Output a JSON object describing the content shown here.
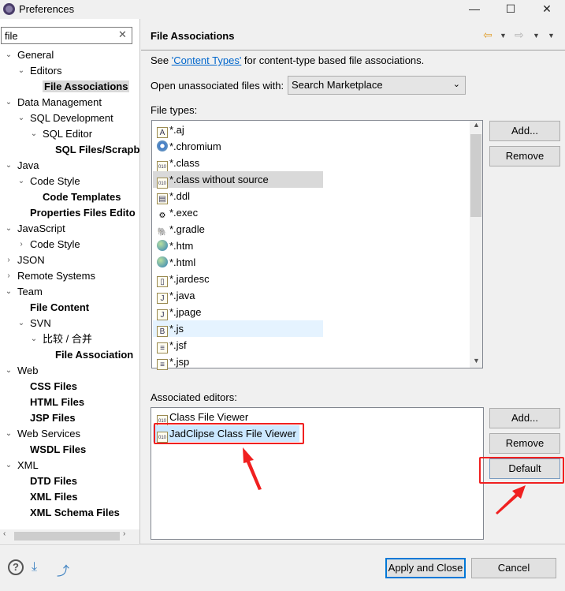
{
  "window": {
    "title": "Preferences",
    "icon": "eclipse-gear-icon",
    "minimize": "—",
    "maximize": "☐",
    "close": "✕"
  },
  "search": {
    "value": "file",
    "clear": "✕"
  },
  "tree": [
    {
      "label": "General",
      "level": 0,
      "state": "expanded"
    },
    {
      "label": "Editors",
      "level": 1,
      "state": "expanded"
    },
    {
      "label": "File Associations",
      "level": 2,
      "state": "leaf",
      "bold": true,
      "selected": true
    },
    {
      "label": "Data Management",
      "level": 0,
      "state": "expanded"
    },
    {
      "label": "SQL Development",
      "level": 1,
      "state": "expanded"
    },
    {
      "label": "SQL Editor",
      "level": 2,
      "state": "expanded"
    },
    {
      "label": "SQL Files/Scrapb",
      "level": 3,
      "state": "leaf",
      "bold": true
    },
    {
      "label": "Java",
      "level": 0,
      "state": "expanded"
    },
    {
      "label": "Code Style",
      "level": 1,
      "state": "expanded"
    },
    {
      "label": "Code Templates",
      "level": 2,
      "state": "leaf",
      "bold": true
    },
    {
      "label": "Properties Files Edito",
      "level": 1,
      "state": "leaf",
      "bold": true
    },
    {
      "label": "JavaScript",
      "level": 0,
      "state": "expanded"
    },
    {
      "label": "Code Style",
      "level": 1,
      "state": "collapsed"
    },
    {
      "label": "JSON",
      "level": 0,
      "state": "collapsed"
    },
    {
      "label": "Remote Systems",
      "level": 0,
      "state": "collapsed"
    },
    {
      "label": "Team",
      "level": 0,
      "state": "expanded"
    },
    {
      "label": "File Content",
      "level": 1,
      "state": "leaf",
      "bold": true
    },
    {
      "label": "SVN",
      "level": 1,
      "state": "expanded"
    },
    {
      "label": "比较 / 合并",
      "level": 2,
      "state": "expanded"
    },
    {
      "label": "File Association",
      "level": 3,
      "state": "leaf",
      "bold": true
    },
    {
      "label": "Web",
      "level": 0,
      "state": "expanded"
    },
    {
      "label": "CSS Files",
      "level": 1,
      "state": "leaf",
      "bold": true
    },
    {
      "label": "HTML Files",
      "level": 1,
      "state": "leaf",
      "bold": true
    },
    {
      "label": "JSP Files",
      "level": 1,
      "state": "leaf",
      "bold": true
    },
    {
      "label": "Web Services",
      "level": 0,
      "state": "expanded"
    },
    {
      "label": "WSDL Files",
      "level": 1,
      "state": "leaf",
      "bold": true
    },
    {
      "label": "XML",
      "level": 0,
      "state": "expanded"
    },
    {
      "label": "DTD Files",
      "level": 1,
      "state": "leaf",
      "bold": true
    },
    {
      "label": "XML Files",
      "level": 1,
      "state": "leaf",
      "bold": true
    },
    {
      "label": "XML Schema Files",
      "level": 1,
      "state": "leaf",
      "bold": true
    }
  ],
  "page": {
    "title": "File Associations",
    "see_prefix": "See ",
    "see_link": "'Content Types'",
    "see_suffix": " for content-type based file associations.",
    "open_label": "Open unassociated files with:",
    "open_value": "Search Marketplace",
    "file_types_label": "File types:",
    "file_types": [
      {
        "label": "*.aj",
        "icon": "aspectj-file-icon"
      },
      {
        "label": "*.chromium",
        "icon": "chromium-icon"
      },
      {
        "label": "*.class",
        "icon": "class-file-icon"
      },
      {
        "label": "*.class without source",
        "icon": "class-file-icon",
        "state": "hover"
      },
      {
        "label": "*.ddl",
        "icon": "ddl-file-icon"
      },
      {
        "label": "*.exec",
        "icon": "gears-icon"
      },
      {
        "label": "*.gradle",
        "icon": "gradle-elephant-icon"
      },
      {
        "label": "*.htm",
        "icon": "globe-icon"
      },
      {
        "label": "*.html",
        "icon": "globe-icon"
      },
      {
        "label": "*.jardesc",
        "icon": "jar-file-icon"
      },
      {
        "label": "*.java",
        "icon": "java-file-icon"
      },
      {
        "label": "*.jpage",
        "icon": "jpage-file-icon"
      },
      {
        "label": "*.js",
        "icon": "js-file-icon",
        "state": "selected"
      },
      {
        "label": "*.jsf",
        "icon": "text-file-icon"
      },
      {
        "label": "*.jsp",
        "icon": "text-file-icon"
      }
    ],
    "add": "Add...",
    "remove": "Remove",
    "editors_label": "Associated editors:",
    "editors": [
      {
        "label": "Class File Viewer",
        "icon": "class-file-icon"
      },
      {
        "label": "JadClipse Class File Viewer",
        "icon": "class-file-icon",
        "selected": true
      }
    ],
    "default": "Default"
  },
  "footer": {
    "apply_close": "Apply and Close",
    "cancel": "Cancel"
  },
  "colors": {
    "annotation": "#f02020",
    "selection": "#cce8ff",
    "link": "#0066cc",
    "focus": "#0078d7"
  }
}
